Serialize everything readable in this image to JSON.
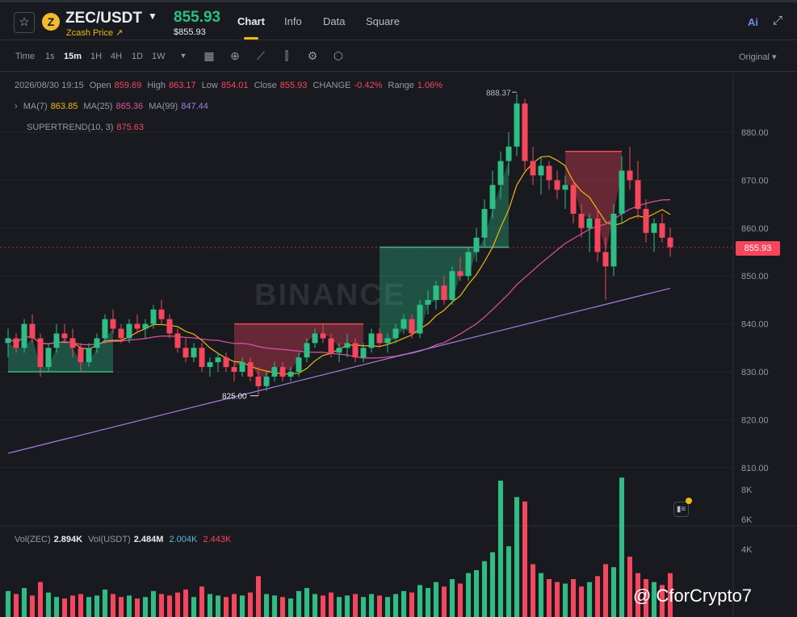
{
  "header": {
    "favorite_icon": "star-outline-icon",
    "coin_icon": "zcash-logo-icon",
    "coin_glyph": "Z",
    "pair": "ZEC/USDT",
    "subname": "Zcash Price ↗",
    "price": "855.93",
    "price_usd": "$855.93",
    "tabs": [
      "Chart",
      "Info",
      "Data",
      "Square"
    ],
    "ai_label": "Ai"
  },
  "toolbar": {
    "timeframes": [
      "Time",
      "1s",
      "15m",
      "1H",
      "4H",
      "1D",
      "1W"
    ],
    "active_timeframe": "15m",
    "icons": [
      "calendar-icon",
      "plus-circle-icon",
      "indicator-icon",
      "candle-type-icon",
      "settings-icon",
      "layers-icon"
    ],
    "view_mode": "Original ▾"
  },
  "legend": {
    "ohlc": {
      "date": "2026/08/30 19:15",
      "open_label": "Open",
      "open": "859.69",
      "high_label": "High",
      "high": "863.17",
      "low_label": "Low",
      "low": "854.01",
      "close_label": "Close",
      "close": "855.93",
      "change_label": "CHANGE",
      "change": "-0.42%",
      "range_label": "Range",
      "range": "1.06%"
    },
    "ma": [
      {
        "label": "MA(7)",
        "value": "863.85",
        "color": "#f0b90b"
      },
      {
        "label": "MA(25)",
        "value": "865.36",
        "color": "#e052a5"
      },
      {
        "label": "MA(99)",
        "value": "847.44",
        "color": "#a47ee0"
      }
    ],
    "supertrend": {
      "label": "SUPERTREND(10, 3)",
      "value": "875.63"
    },
    "volume": {
      "vol_zec_label": "Vol(ZEC)",
      "vol_zec": "2.894K",
      "vol_usdt_label": "Vol(USDT)",
      "vol_usdt": "2.484M",
      "v1": "2.004K",
      "v2": "2.443K"
    }
  },
  "price_axis": [
    "880.00",
    "870.00",
    "860.00",
    "850.00",
    "840.00",
    "830.00",
    "820.00",
    "810.00"
  ],
  "volume_axis": [
    "8K",
    "6K",
    "4K"
  ],
  "annotations": {
    "high": "888.37",
    "low": "825.00"
  },
  "current_price_tag": "855.93",
  "watermark": "BINANCE",
  "credit": "@ CforCrypto7",
  "colors": {
    "up": "#2ebd85",
    "down": "#f6465d",
    "accent": "#f0b90b"
  },
  "chart_data": {
    "type": "candlestick",
    "ylim": [
      800,
      890
    ],
    "candles": [
      [
        836,
        839,
        833,
        837
      ],
      [
        837,
        838,
        834,
        835
      ],
      [
        835,
        841,
        834,
        840
      ],
      [
        840,
        842,
        836,
        837
      ],
      [
        837,
        838,
        829,
        831
      ],
      [
        831,
        836,
        830,
        835
      ],
      [
        835,
        840,
        834,
        838
      ],
      [
        838,
        840,
        836,
        837
      ],
      [
        837,
        839,
        833,
        835
      ],
      [
        835,
        836,
        830,
        832
      ],
      [
        832,
        836,
        831,
        835
      ],
      [
        835,
        838,
        834,
        837
      ],
      [
        837,
        842,
        836,
        841
      ],
      [
        841,
        843,
        838,
        839
      ],
      [
        839,
        840,
        836,
        837
      ],
      [
        837,
        841,
        836,
        840
      ],
      [
        840,
        842,
        838,
        839
      ],
      [
        839,
        841,
        837,
        840
      ],
      [
        840,
        844,
        839,
        843
      ],
      [
        843,
        845,
        840,
        841
      ],
      [
        841,
        842,
        837,
        838
      ],
      [
        838,
        839,
        834,
        835
      ],
      [
        835,
        837,
        832,
        833
      ],
      [
        833,
        836,
        832,
        835
      ],
      [
        835,
        836,
        830,
        831
      ],
      [
        831,
        833,
        829,
        832
      ],
      [
        832,
        834,
        830,
        833
      ],
      [
        833,
        834,
        830,
        831
      ],
      [
        831,
        832,
        828,
        830
      ],
      [
        830,
        833,
        829,
        832
      ],
      [
        832,
        833,
        828,
        829
      ],
      [
        829,
        831,
        825,
        827
      ],
      [
        827,
        830,
        826,
        829
      ],
      [
        829,
        832,
        828,
        831
      ],
      [
        831,
        832,
        828,
        829
      ],
      [
        829,
        831,
        828,
        830
      ],
      [
        830,
        834,
        829,
        833
      ],
      [
        833,
        837,
        832,
        836
      ],
      [
        836,
        839,
        835,
        838
      ],
      [
        838,
        840,
        836,
        837
      ],
      [
        837,
        838,
        833,
        834
      ],
      [
        834,
        836,
        832,
        835
      ],
      [
        835,
        838,
        833,
        836
      ],
      [
        836,
        837,
        832,
        833
      ],
      [
        833,
        836,
        832,
        835
      ],
      [
        835,
        839,
        834,
        838
      ],
      [
        838,
        839,
        835,
        836
      ],
      [
        836,
        838,
        834,
        837
      ],
      [
        837,
        840,
        836,
        839
      ],
      [
        839,
        842,
        838,
        841
      ],
      [
        841,
        842,
        837,
        838
      ],
      [
        838,
        845,
        837,
        844
      ],
      [
        844,
        847,
        842,
        845
      ],
      [
        845,
        849,
        843,
        848
      ],
      [
        848,
        850,
        844,
        845
      ],
      [
        845,
        852,
        844,
        851
      ],
      [
        851,
        854,
        849,
        850
      ],
      [
        850,
        856,
        849,
        855
      ],
      [
        855,
        860,
        853,
        858
      ],
      [
        858,
        866,
        856,
        864
      ],
      [
        864,
        872,
        862,
        869
      ],
      [
        869,
        876,
        866,
        874
      ],
      [
        874,
        880,
        871,
        877
      ],
      [
        877,
        888,
        875,
        886
      ],
      [
        886,
        887,
        872,
        874
      ],
      [
        874,
        877,
        869,
        871
      ],
      [
        871,
        875,
        867,
        873
      ],
      [
        873,
        874,
        868,
        870
      ],
      [
        870,
        872,
        866,
        868
      ],
      [
        868,
        871,
        864,
        869
      ],
      [
        869,
        870,
        861,
        863
      ],
      [
        863,
        865,
        858,
        860
      ],
      [
        860,
        863,
        855,
        862
      ],
      [
        862,
        864,
        853,
        855
      ],
      [
        855,
        858,
        845,
        852
      ],
      [
        852,
        865,
        850,
        863
      ],
      [
        863,
        875,
        861,
        872
      ],
      [
        872,
        877,
        868,
        870
      ],
      [
        870,
        874,
        862,
        864
      ],
      [
        864,
        866,
        857,
        859
      ],
      [
        859,
        862,
        855,
        861
      ],
      [
        861,
        863,
        857,
        858
      ],
      [
        858,
        860,
        854,
        856
      ]
    ],
    "supertrend_up_segments": [
      {
        "from": 0,
        "to": 13,
        "value": 830
      },
      {
        "from": 46,
        "to": 62,
        "value": 856
      }
    ],
    "supertrend_down_segments": [
      {
        "from": 28,
        "to": 44,
        "value": 840
      },
      {
        "from": 69,
        "to": 76,
        "value": 876
      }
    ],
    "volume": [
      1.2,
      1.0,
      1.4,
      0.9,
      1.8,
      1.1,
      0.8,
      0.7,
      0.9,
      1.0,
      0.8,
      0.9,
      1.3,
      1.0,
      0.8,
      0.9,
      0.7,
      0.8,
      1.2,
      1.0,
      0.9,
      1.1,
      1.3,
      0.8,
      1.5,
      1.0,
      0.9,
      0.8,
      1.0,
      0.9,
      1.1,
      2.2,
      1.0,
      0.9,
      0.8,
      0.7,
      1.2,
      1.4,
      1.0,
      0.9,
      1.1,
      0.8,
      0.9,
      1.0,
      0.8,
      1.0,
      0.9,
      0.8,
      1.0,
      1.2,
      1.1,
      1.6,
      1.4,
      1.8,
      1.5,
      2.0,
      1.7,
      2.4,
      2.6,
      3.2,
      3.8,
      8.6,
      4.2,
      7.5,
      7.2,
      3.0,
      2.4,
      2.0,
      1.8,
      1.7,
      2.0,
      1.5,
      1.8,
      2.2,
      3.0,
      2.8,
      8.8,
      3.5,
      2.4,
      2.0,
      1.8,
      1.6,
      2.4
    ]
  }
}
